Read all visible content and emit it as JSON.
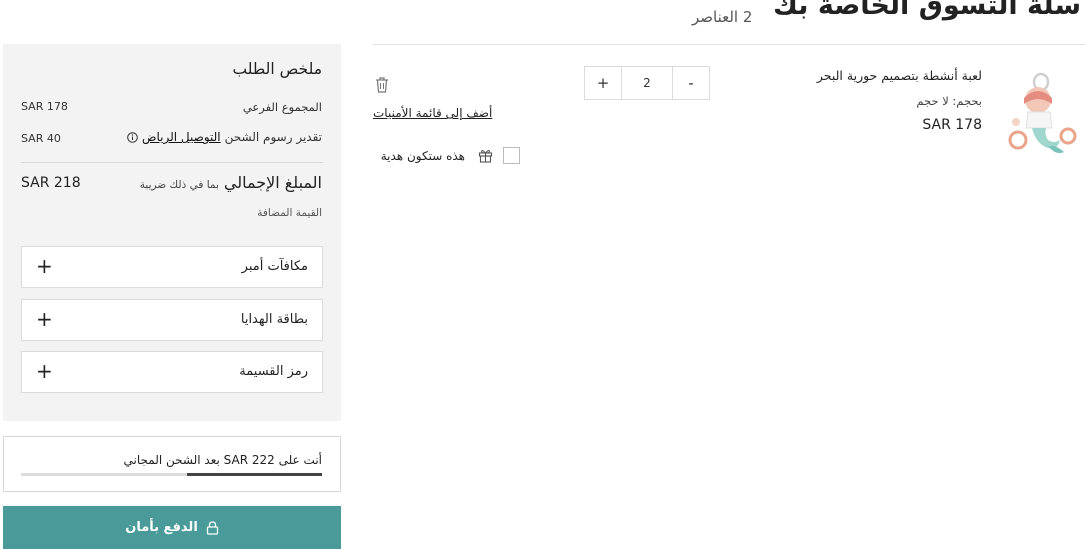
{
  "header": {
    "title": "سلة التسوق الخاصة بك",
    "items_count": "2 العناصر"
  },
  "cart_item": {
    "name": "لعبة أنشطة بتصميم حورية البحر",
    "size_label": "بحجم:",
    "size_value": "لا حجم",
    "price": "SAR 178",
    "quantity": "2",
    "increment_label": "+",
    "decrement_label": "-",
    "wishlist_link": "أضف إلى قائمة الأمنيات",
    "gift_label": "هذه ستكون هدية",
    "icons": {
      "delete": "trash-icon",
      "gift": "gift-icon",
      "product": "product-image"
    }
  },
  "summary": {
    "title": "ملخص الطلب",
    "subtotal_label": "المجموع الفرعي",
    "subtotal_value": "SAR 178",
    "shipping_estimate_label": "تقدير رسوم الشحن",
    "shipping_estimate_link": "التوصيل الرياض",
    "shipping_value": "SAR 40",
    "total_label": "المبلغ الإجمالي",
    "total_vat_note": "بما في ذلك ضريبة",
    "total_vat_note2": "القيمة المضافة",
    "total_value": "SAR 218",
    "accordions": [
      {
        "label": "مكافآت أمبر",
        "toggle": "+"
      },
      {
        "label": "بطاقة الهدايا",
        "toggle": "+"
      },
      {
        "label": "رمز القسيمة",
        "toggle": "+"
      }
    ]
  },
  "free_shipping": {
    "text": "أنت على SAR 222 بعد الشحن المجاني",
    "progress": 0.45
  },
  "checkout": {
    "pay_label": "الدفع بأمان",
    "accent_color": "#4a9a99"
  }
}
